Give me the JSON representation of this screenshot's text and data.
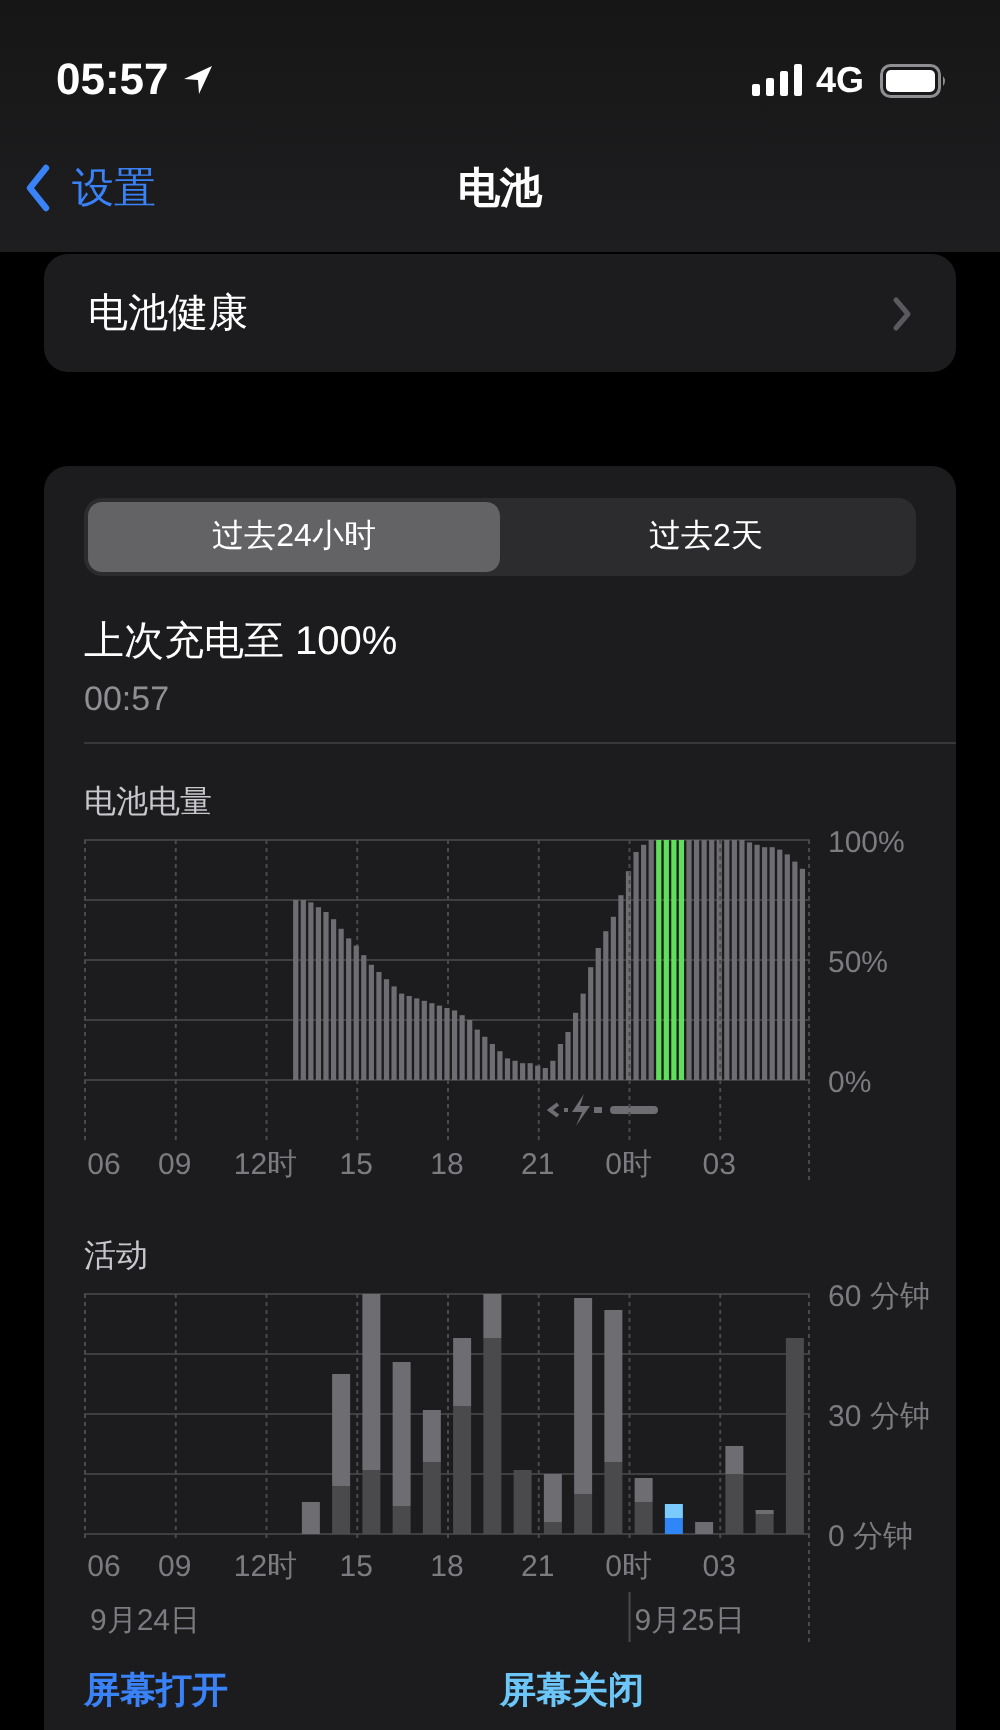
{
  "status_bar": {
    "time": "05:57",
    "network": "4G"
  },
  "nav": {
    "back": "设置",
    "title": "电池"
  },
  "health_row": {
    "label": "电池健康"
  },
  "segments": [
    {
      "label": "过去24小时",
      "selected": true
    },
    {
      "label": "过去2天",
      "selected": false
    }
  ],
  "last_charge": {
    "title": "上次充电至 100%",
    "time": "00:57"
  },
  "battery_level": {
    "title": "电池电量",
    "next_day_labels": [
      "0时",
      "03"
    ],
    "chart_data": {
      "type": "bar",
      "grid": true,
      "xlim": [
        6,
        30
      ],
      "ylim": [
        0,
        100
      ],
      "x": [
        13,
        13.25,
        13.5,
        13.75,
        14,
        14.25,
        14.5,
        14.75,
        15,
        15.25,
        15.5,
        15.75,
        16,
        16.25,
        16.5,
        16.75,
        17,
        17.25,
        17.5,
        17.75,
        18,
        18.25,
        18.5,
        18.75,
        19,
        19.25,
        19.5,
        19.75,
        20,
        20.25,
        20.5,
        20.75,
        21,
        21.25,
        21.5,
        21.75,
        22,
        22.25,
        22.5,
        22.75,
        23,
        23.25,
        23.5,
        23.75,
        24,
        24.25,
        24.5,
        24.75,
        25,
        25.25,
        25.5,
        25.75,
        26,
        26.25,
        26.5,
        26.75,
        27,
        27.25,
        27.5,
        27.75,
        28,
        28.25,
        28.5,
        28.75,
        29,
        29.25,
        29.5,
        29.75
      ],
      "series": [
        {
          "color": "#6e6e72",
          "values": [
            75,
            75,
            74,
            72,
            70,
            67,
            63,
            59,
            56,
            52,
            48,
            45,
            42,
            39,
            36,
            35,
            34,
            33,
            32,
            31,
            30,
            29,
            27,
            25,
            21,
            18,
            15,
            12,
            9,
            8,
            7,
            7,
            6,
            5,
            8,
            15,
            20,
            28,
            36,
            47,
            55,
            62,
            68,
            77,
            87,
            95,
            98,
            100,
            null,
            null,
            null,
            null,
            100,
            100,
            100,
            100,
            100,
            100,
            100,
            100,
            99,
            98,
            97,
            97,
            96,
            94,
            91,
            88
          ]
        },
        {
          "color": "#5fe05a",
          "values": [
            null,
            null,
            null,
            null,
            null,
            null,
            null,
            null,
            null,
            null,
            null,
            null,
            null,
            null,
            null,
            null,
            null,
            null,
            null,
            null,
            null,
            null,
            null,
            null,
            null,
            null,
            null,
            null,
            null,
            null,
            null,
            null,
            null,
            null,
            null,
            null,
            null,
            null,
            null,
            null,
            null,
            null,
            null,
            null,
            null,
            null,
            null,
            null,
            100,
            100,
            100,
            100,
            null,
            null,
            null,
            null,
            null,
            null,
            null,
            null,
            null,
            null,
            null,
            null,
            null,
            null,
            null,
            null
          ]
        }
      ],
      "xticks": [
        {
          "value": 6,
          "label": "06"
        },
        {
          "value": 9,
          "label": "09"
        },
        {
          "value": 12,
          "label": "12时"
        },
        {
          "value": 15,
          "label": "15"
        },
        {
          "value": 18,
          "label": "18"
        },
        {
          "value": 21,
          "label": "21"
        }
      ],
      "yticks": [
        {
          "value": 0,
          "label": "0%"
        },
        {
          "value": 50,
          "label": "50%"
        },
        {
          "value": 100,
          "label": "100%"
        }
      ]
    }
  },
  "activity": {
    "title": "活动",
    "next_day_labels": [
      "0时",
      "03"
    ],
    "chart_data": {
      "type": "bar",
      "grid": true,
      "stacked": true,
      "xlim": [
        6,
        30
      ],
      "ylim": [
        0,
        60
      ],
      "x": [
        13.5,
        14.5,
        15.5,
        16.5,
        17.5,
        18.5,
        19.5,
        20.5,
        21.5,
        22.5,
        23.5,
        24.5,
        25.5,
        26.5,
        27.5,
        28.5,
        29.5
      ],
      "series": [
        {
          "color": "#4a4a4d",
          "values": [
            0,
            12,
            16,
            7,
            18,
            32,
            49,
            16,
            3,
            10,
            18,
            8,
            null,
            0,
            15,
            5,
            49
          ]
        },
        {
          "color": "#6e6e72",
          "values": [
            8,
            28,
            44,
            36,
            13,
            17,
            11,
            0,
            12,
            49,
            38,
            6,
            null,
            3,
            7,
            1,
            0
          ]
        },
        {
          "color": "#2f86f6",
          "values": [
            null,
            null,
            null,
            null,
            null,
            null,
            null,
            null,
            null,
            null,
            null,
            null,
            4,
            null,
            null,
            null,
            null
          ]
        },
        {
          "color": "#7ccbff",
          "values": [
            null,
            null,
            null,
            null,
            null,
            null,
            null,
            null,
            null,
            null,
            null,
            null,
            3.5,
            null,
            null,
            null,
            null
          ]
        }
      ],
      "xticks": [
        {
          "value": 6,
          "label": "06"
        },
        {
          "value": 9,
          "label": "09"
        },
        {
          "value": 12,
          "label": "12时"
        },
        {
          "value": 15,
          "label": "15"
        },
        {
          "value": 18,
          "label": "18"
        },
        {
          "value": 21,
          "label": "21"
        }
      ],
      "yticks": [
        {
          "value": 0,
          "label": "0 分钟"
        },
        {
          "value": 30,
          "label": "30 分钟"
        },
        {
          "value": 60,
          "label": "60 分钟"
        }
      ],
      "annotations": [
        "9月24日",
        "9月25日"
      ]
    }
  },
  "legend": [
    {
      "label": "屏幕打开",
      "color": "#3a82f7"
    },
    {
      "label": "屏幕关闭",
      "color": "#6cc6f7"
    }
  ]
}
